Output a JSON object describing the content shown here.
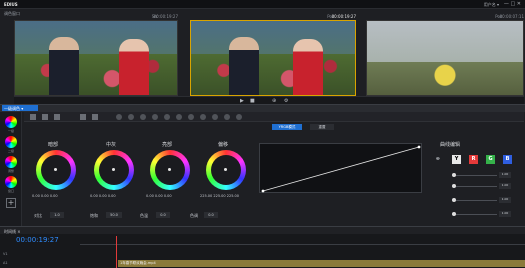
{
  "app": {
    "logo": "EDIUS",
    "title": "调色窗口",
    "user": "用户名 ▾",
    "window_controls": "— □ ✕"
  },
  "monitors": [
    {
      "label": "Src",
      "timecode": "00:00:19:27",
      "active": false
    },
    {
      "label": "Pos",
      "timecode": "00:00:19:27",
      "active": true
    },
    {
      "label": "Pos",
      "timecode": "00:00:07:11",
      "active": false
    }
  ],
  "panel": {
    "tab_label": "一级调色 ▾",
    "left_labels": [
      "一级",
      "二级",
      "调整",
      "窗口"
    ],
    "mode_button": "YRGB模式",
    "reset_button": "重置"
  },
  "wheels": [
    {
      "title": "暗部",
      "values": [
        "0.00",
        "0.00",
        "0.00"
      ]
    },
    {
      "title": "中灰",
      "values": [
        "0.00",
        "0.00",
        "0.00"
      ]
    },
    {
      "title": "亮部",
      "values": [
        "0.00",
        "0.00",
        "0.00"
      ]
    },
    {
      "title": "偏移",
      "values": [
        "225.00",
        "225.00",
        "225.00"
      ]
    }
  ],
  "controls": {
    "contrast_label": "对比",
    "contrast_value": "1.0",
    "saturation_label": "饱和",
    "saturation_value": "50.0",
    "color_temp_label": "色温",
    "color_temp_value": "0.0",
    "tint_label": "色调",
    "tint_value": "0.0"
  },
  "curves": {
    "title": "曲线编辑",
    "channels": [
      "Y",
      "R",
      "G",
      "B"
    ],
    "slider_values": [
      "1.00",
      "1.00",
      "1.00",
      "1.00"
    ]
  },
  "timeline": {
    "header": "时间线  ×",
    "timecode": "00:00:19:27",
    "tracks": [
      "V1",
      "A1"
    ],
    "clip_label": "1年春节联欢晚会.mp4"
  },
  "colors": {
    "accent": "#1f6fd1",
    "timecode_blue": "#2f8cff",
    "active_border": "#d9a400",
    "playhead": "#e23a3a"
  }
}
